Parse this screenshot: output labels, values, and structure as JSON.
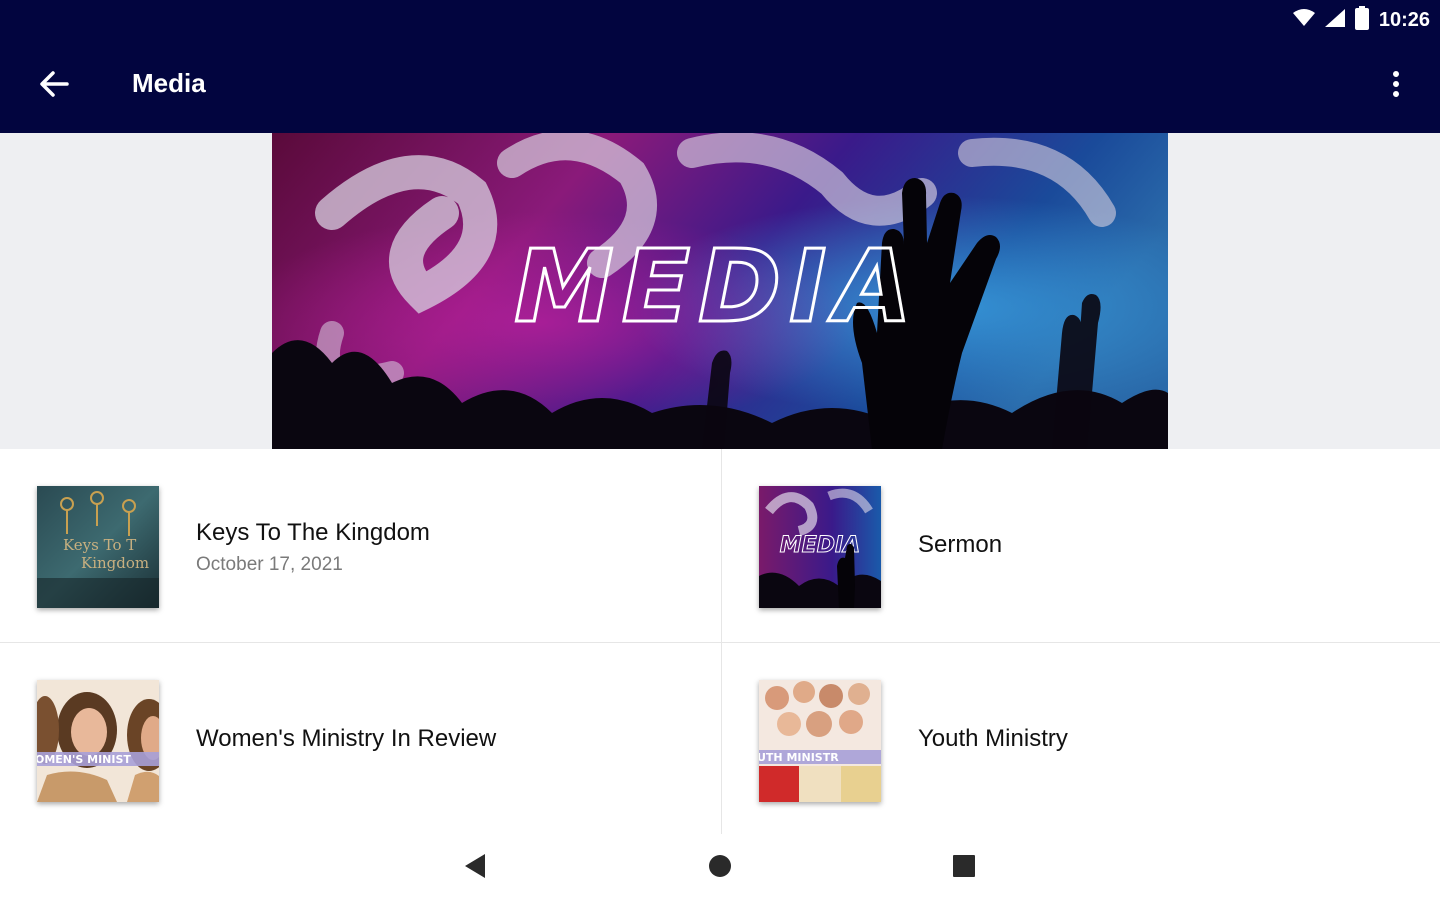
{
  "status_bar": {
    "time": "10:26",
    "icons": [
      "wifi-icon",
      "cell-signal-icon",
      "battery-icon"
    ]
  },
  "app_bar": {
    "title": "Media",
    "back_icon": "arrow-left-icon",
    "menu_icon": "more-vert-icon",
    "background_color": "#02053f"
  },
  "banner": {
    "text": "MEDIA"
  },
  "media_items": [
    {
      "title": "Keys To The Kingdom",
      "date": "October 17, 2021",
      "thumbnail_text": [
        "Keys To T",
        "Kingdom"
      ]
    },
    {
      "title": "Sermon",
      "thumbnail_text": [
        "MEDIA"
      ]
    },
    {
      "title": "Women's Ministry In Review",
      "thumbnail_text": [
        "OMEN'S MINIST"
      ]
    },
    {
      "title": "Youth Ministry",
      "thumbnail_text": [
        "UTH MINISTR"
      ]
    }
  ],
  "nav_bar": {
    "icons": [
      "nav-back-icon",
      "nav-home-icon",
      "nav-recents-icon"
    ]
  }
}
